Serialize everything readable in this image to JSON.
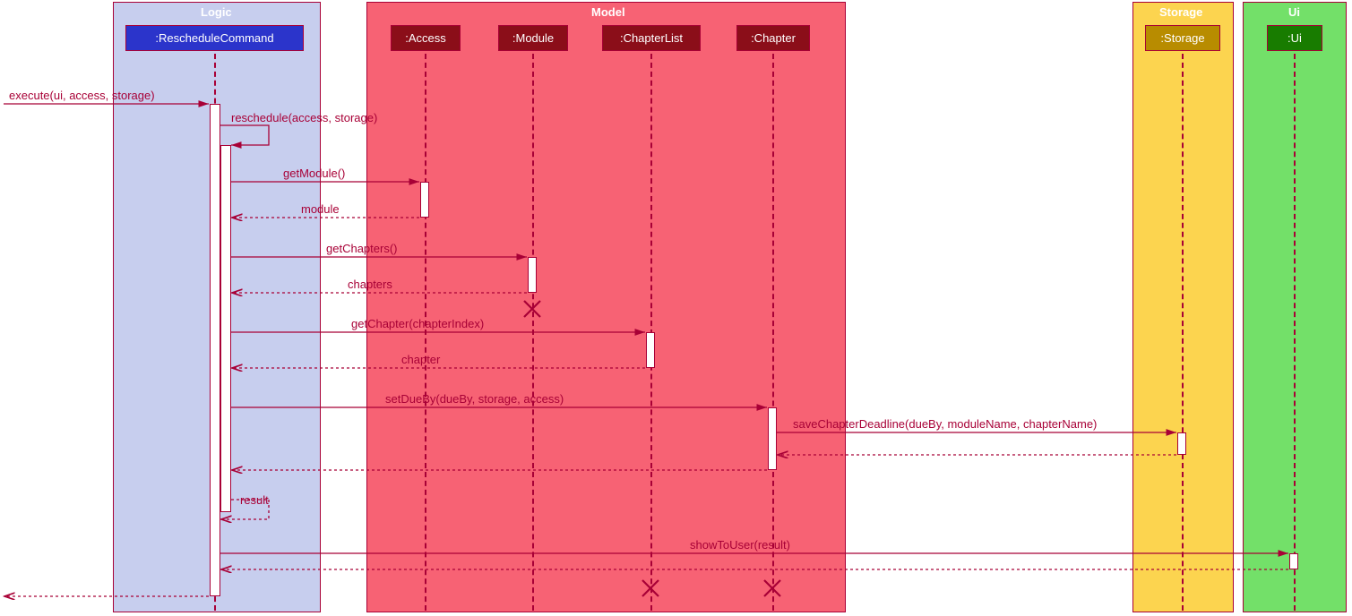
{
  "boxes": {
    "logic": {
      "title": "Logic",
      "bg": "#c7ceee",
      "border": "#a80036"
    },
    "model": {
      "title": "Model",
      "bg": "#f76274",
      "border": "#a80036"
    },
    "storage": {
      "title": "Storage",
      "bg": "#fcd44f",
      "border": "#a80036"
    },
    "ui": {
      "title": "Ui",
      "bg": "#73e069",
      "border": "#a80036"
    }
  },
  "participants": {
    "reschedule": {
      "label": ":RescheduleCommand",
      "bg": "#2b34cb",
      "fg": "#ffffff",
      "border": "#a80036"
    },
    "access": {
      "label": ":Access",
      "bg": "#8b0e19",
      "fg": "#ffffff",
      "border": "#a80036"
    },
    "module": {
      "label": ":Module",
      "bg": "#8b0e19",
      "fg": "#ffffff",
      "border": "#a80036"
    },
    "chapterlist": {
      "label": ":ChapterList",
      "bg": "#8b0e19",
      "fg": "#ffffff",
      "border": "#a80036"
    },
    "chapter": {
      "label": ":Chapter",
      "bg": "#8b0e19",
      "fg": "#ffffff",
      "border": "#a80036"
    },
    "storage": {
      "label": ":Storage",
      "bg": "#b88c00",
      "fg": "#ffffff",
      "border": "#a80036"
    },
    "ui": {
      "label": ":Ui",
      "bg": "#187c00",
      "fg": "#ffffff",
      "border": "#a80036"
    }
  },
  "msgs": {
    "execute": "execute(ui, access, storage)",
    "reschedule": "reschedule(access, storage)",
    "getModule": "getModule()",
    "module": "module",
    "getChapters": "getChapters()",
    "chapters": "chapters",
    "getChapter": "getChapter(chapterIndex)",
    "chapter": "chapter",
    "setDueBy": "setDueBy(dueBy, storage, access)",
    "saveDeadline": "saveChapterDeadline(dueBy, moduleName, chapterName)",
    "result": "result",
    "showToUser": "showToUser(result)"
  },
  "colors": {
    "line": "#a80036",
    "txt": "#a80036",
    "white": "#ffffff"
  }
}
